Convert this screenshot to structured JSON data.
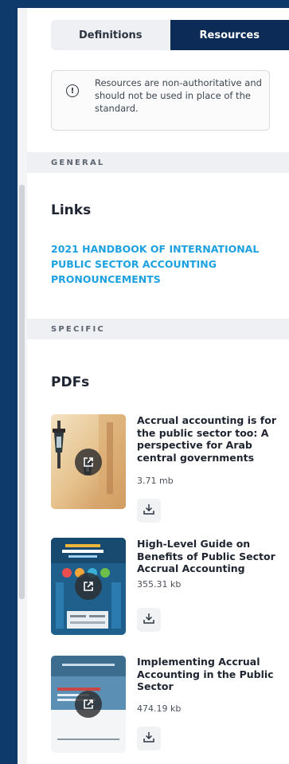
{
  "tabs": {
    "definitions": "Definitions",
    "resources": "Resources",
    "active": "resources"
  },
  "notice": {
    "icon": "info-icon",
    "text": "Resources are non-authoritative and should not be used in place of the standard."
  },
  "sections": {
    "general": "GENERAL",
    "specific": "SPECIFIC"
  },
  "links_heading": "Links",
  "link_text": "2021 Handbook of International Public Sector Accounting Pronouncements",
  "pdfs_heading": "PDFs",
  "pdfs": [
    {
      "title": "Accrual accounting is for the public sector too: A perspective for Arab central governments",
      "size": "3.71 mb"
    },
    {
      "title": "High-Level Guide on Benefits of Public Sector Accrual Accounting",
      "size": "355.31 kb"
    },
    {
      "title": "Implementing Accrual Accounting in the Public Sector",
      "size": "474.19 kb"
    }
  ],
  "colors": {
    "active_tab": "#0c2b56",
    "link": "#1da1e0",
    "page_bg": "#0d3a6b"
  }
}
